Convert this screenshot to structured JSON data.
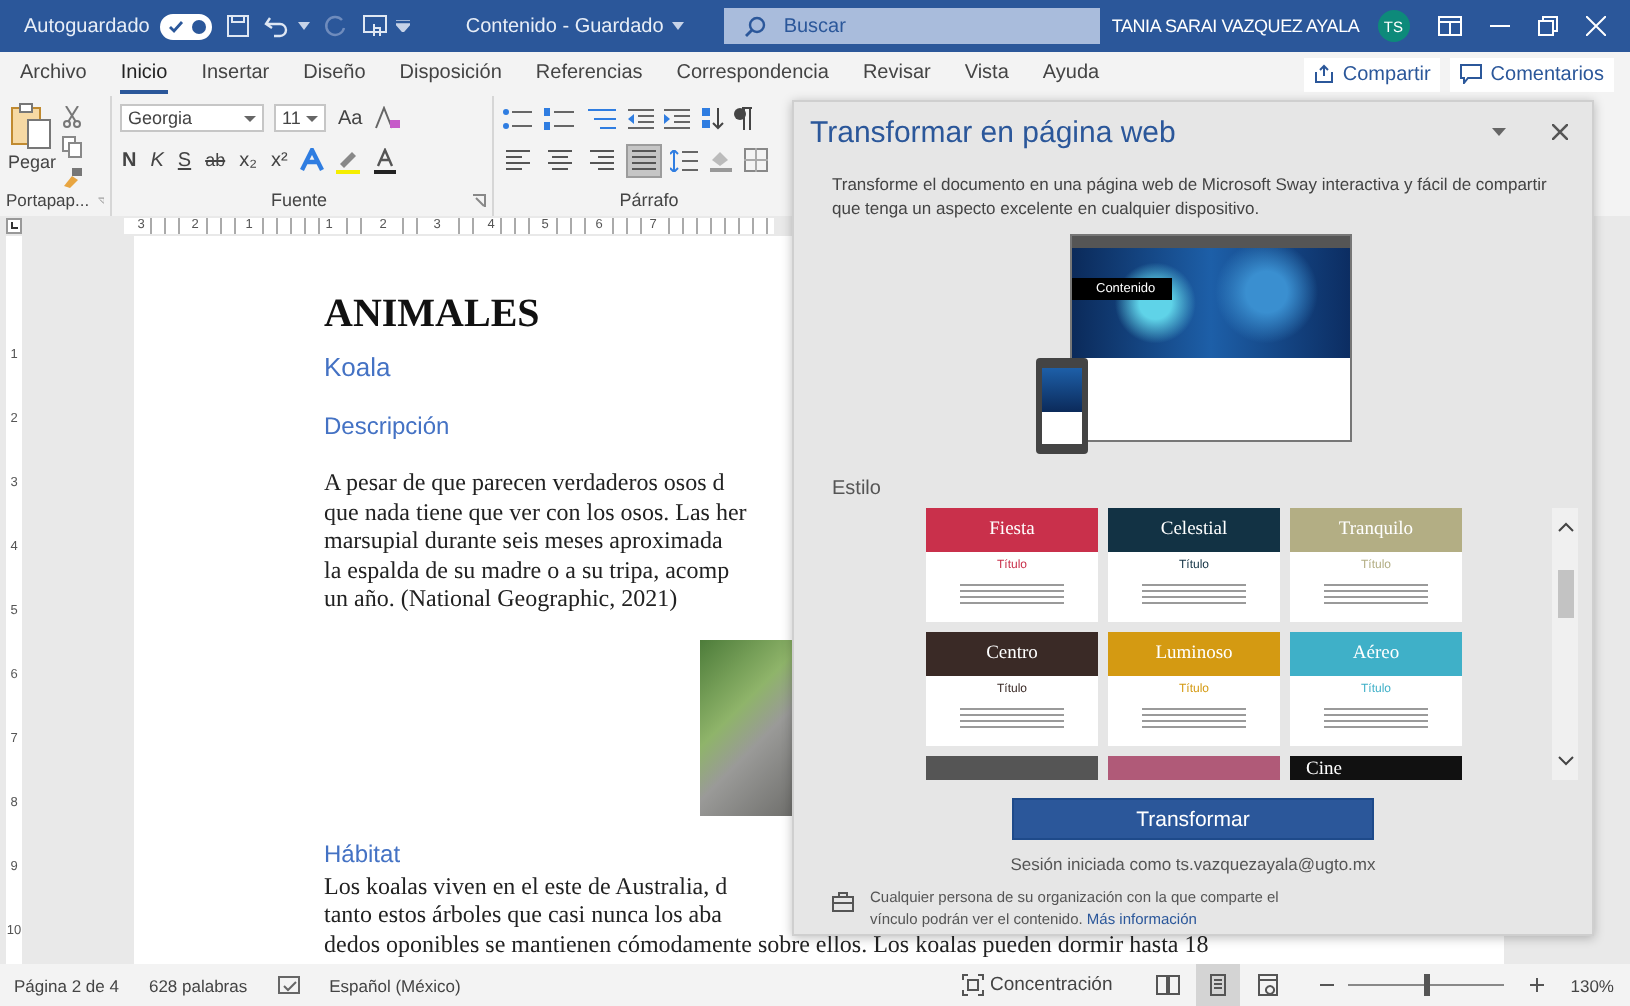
{
  "title_bar": {
    "autosave_label": "Autoguardado",
    "autosave_on": true,
    "document_title": "Contenido - Guardado",
    "search": {
      "placeholder": "Buscar"
    },
    "user_name": "TANIA SARAI VAZQUEZ AYALA",
    "avatar_initials": "TS"
  },
  "ribbon_tabs": [
    {
      "label": "Archivo",
      "selected": false
    },
    {
      "label": "Inicio",
      "selected": true
    },
    {
      "label": "Insertar",
      "selected": false
    },
    {
      "label": "Diseño",
      "selected": false
    },
    {
      "label": "Disposición",
      "selected": false
    },
    {
      "label": "Referencias",
      "selected": false
    },
    {
      "label": "Correspondencia",
      "selected": false
    },
    {
      "label": "Revisar",
      "selected": false
    },
    {
      "label": "Vista",
      "selected": false
    },
    {
      "label": "Ayuda",
      "selected": false
    }
  ],
  "share_button": "Compartir",
  "comments_button": "Comentarios",
  "ribbon": {
    "clipboard": {
      "paste_label": "Pegar",
      "group_label": "Portapap..."
    },
    "font": {
      "font_name": "Georgia",
      "font_size": "11",
      "change_case": "Aa",
      "format_buttons": [
        "N",
        "K",
        "S",
        "ab",
        "x₂",
        "x²"
      ],
      "group_label": "Fuente"
    },
    "paragraph": {
      "align_buttons": [
        {
          "kind": "left",
          "selected": false
        },
        {
          "kind": "center",
          "selected": false
        },
        {
          "kind": "right",
          "selected": false
        },
        {
          "kind": "justify",
          "selected": true
        }
      ],
      "group_label": "Párrafo"
    }
  },
  "ruler": {
    "numbers": [
      "3",
      "2",
      "1",
      "1",
      "2",
      "3",
      "4",
      "5",
      "6",
      "7"
    ]
  },
  "vertical_ruler": {
    "numbers": [
      "1",
      "2",
      "3",
      "4",
      "5",
      "6",
      "7",
      "8",
      "9",
      "10"
    ]
  },
  "document": {
    "heading": "ANIMALES",
    "subheading": "Koala",
    "sections": [
      {
        "title": "Descripción",
        "lines": [
          "A pesar de que parecen verdaderos osos d",
          "que nada tiene que ver con los osos. Las her",
          "marsupial durante seis meses aproximada",
          "la espalda de su madre o a su tripa, acomp",
          "un año. (National Geographic, 2021)"
        ]
      },
      {
        "title": "Hábitat",
        "lines": [
          "Los koalas viven en el este de Australia, d",
          "tanto estos árboles que casi nunca los aba",
          "dedos oponibles se mantienen cómodamente sobre ellos. Los koalas pueden dormir hasta 18"
        ]
      }
    ]
  },
  "pane": {
    "title": "Transformar en página web",
    "description": "Transforme el documento en una página web de Microsoft Sway interactiva y fácil de compartir que tenga un aspecto excelente en cualquier dispositivo.",
    "preview_title": "Contenido",
    "style_label": "Estilo",
    "styles": [
      {
        "name": "Fiesta",
        "color": "#c9304b",
        "sample": "Título"
      },
      {
        "name": "Celestial",
        "color": "#123244",
        "sample": "Título"
      },
      {
        "name": "Tranquilo",
        "color": "#b3ae84",
        "sample": "Título"
      },
      {
        "name": "Centro",
        "color": "#3a2a26",
        "sample": "Título"
      },
      {
        "name": "Luminoso",
        "color": "#d49a12",
        "sample": "Título"
      },
      {
        "name": "Aéreo",
        "color": "#3fb0c8",
        "sample": "Título"
      },
      {
        "color": "#555555"
      },
      {
        "color": "#b05a78"
      },
      {
        "name": "Cine",
        "color": "#111111"
      }
    ],
    "transform_button": "Transformar",
    "signed_in": "Sesión iniciada como ts.vazquezayala@ugto.mx",
    "notice": "Cualquier persona de su organización con la que comparte el vínculo podrán ver el contenido.",
    "notice_link": "Más información"
  },
  "status_bar": {
    "page": "Página 2 de 4",
    "words": "628 palabras",
    "language": "Español (México)",
    "focus": "Concentración",
    "views": [
      {
        "kind": "read",
        "selected": false
      },
      {
        "kind": "print",
        "selected": true
      },
      {
        "kind": "web",
        "selected": false
      }
    ],
    "zoom": {
      "level": 0.5,
      "reading": "130%"
    }
  }
}
